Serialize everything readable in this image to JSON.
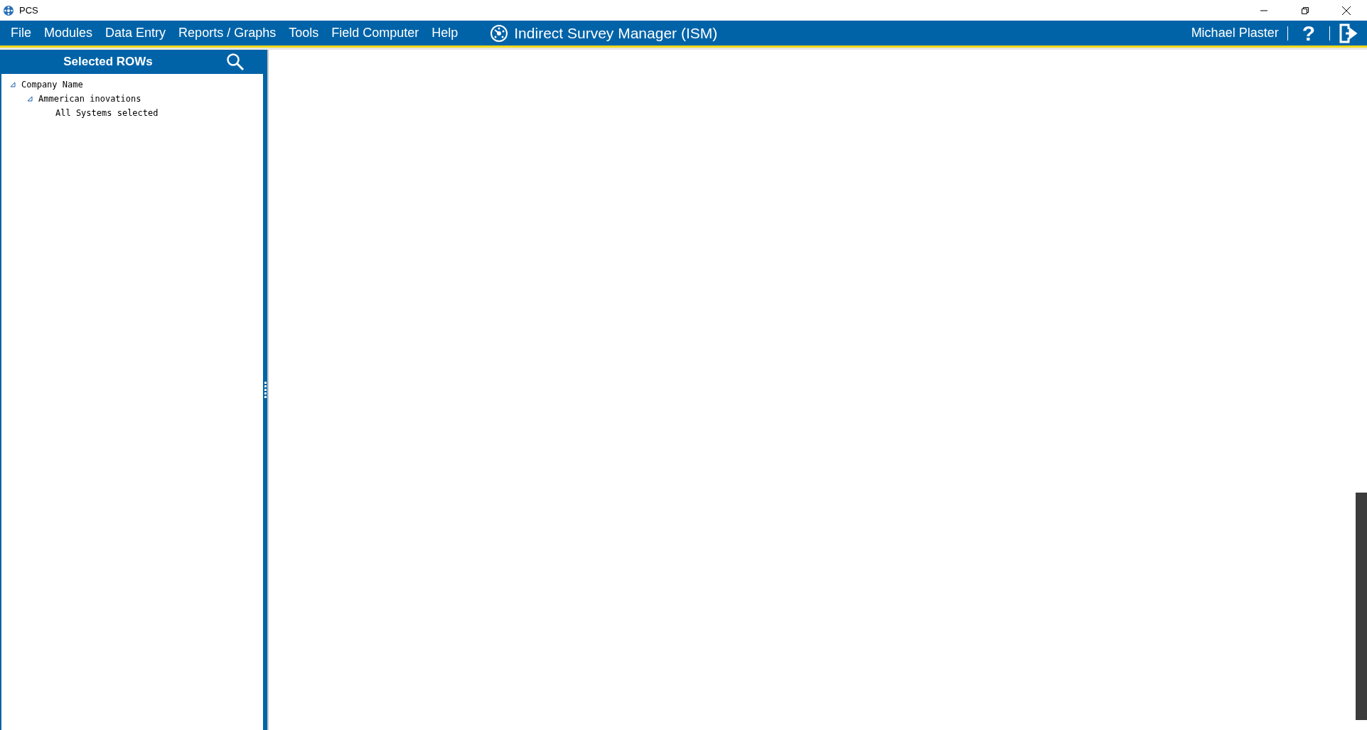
{
  "window": {
    "title": "PCS"
  },
  "menu": [
    "File",
    "Modules",
    "Data Entry",
    "Reports / Graphs",
    "Tools",
    "Field Computer",
    "Help"
  ],
  "app_title": "Indirect Survey Manager (ISM)",
  "user": "Michael Plaster",
  "help_label": "?",
  "sidebar": {
    "title": "Selected ROWs",
    "tree": [
      {
        "label": "Company Name",
        "expanded": true,
        "children": [
          {
            "label": "Ammerican inovations",
            "expanded": true,
            "children": [
              {
                "label": "All Systems selected"
              }
            ]
          }
        ]
      }
    ]
  }
}
